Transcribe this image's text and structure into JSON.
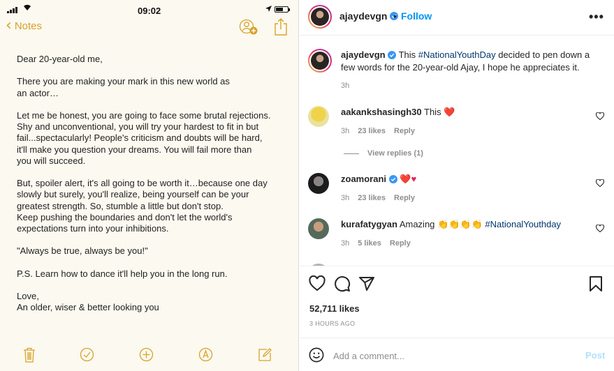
{
  "notes": {
    "status": {
      "time": "09:02"
    },
    "back_label": "Notes",
    "body": {
      "greeting": "Dear 20-year-old me,",
      "p1a": "There you are making your mark in this new world as",
      "p1b": "an actor…",
      "p2a": "Let me be honest, you are going to face some brutal rejections.",
      "p2b": "Shy and unconventional, you will try your hardest to fit in but",
      "p2c": "fail...spectacularly! People's criticism and doubts will be hard,",
      "p2d": "it'll make you question your dreams. You will fail more than",
      "p2e": "you will succeed.",
      "p3a": "But, spoiler alert, it's all going to be worth it…because one day",
      "p3b": "slowly but surely, you'll realize, being yourself can be your",
      "p3c": "greatest strength. So, stumble a little but don't stop.",
      "p3d": "Keep pushing the boundaries and don't let the world's",
      "p3e": "expectations turn into your inhibitions.",
      "quote": "\"Always be true, always be you!\"",
      "ps": "P.S. Learn how to dance it'll help you in the long run.",
      "sign1": "Love,",
      "sign2": "An older, wiser & better looking you"
    },
    "toolbar_icons": [
      "trash-icon",
      "checkmark-circle-icon",
      "plus-circle-icon",
      "markup-pen-icon",
      "compose-icon"
    ]
  },
  "instagram": {
    "header": {
      "username": "ajaydevgn",
      "separator": "•",
      "follow_label": "Follow",
      "more_label": "•••"
    },
    "caption": {
      "username": "ajaydevgn",
      "text_before": "This ",
      "hashtag": "#NationalYouthDay",
      "text_after": " decided to pen down a few words for the 20-year-old Ajay, I hope he appreciates it.",
      "time": "3h"
    },
    "comments": [
      {
        "username": "aakankshasingh30",
        "text": "This ",
        "emoji": "❤️",
        "time": "3h",
        "likes": "23 likes",
        "reply": "Reply"
      },
      {
        "username": "zoamorani",
        "text": "",
        "emoji": "❤️♥",
        "time": "3h",
        "likes": "23 likes",
        "reply": "Reply"
      },
      {
        "username": "kurafatygyan",
        "text": "Amazing ",
        "emoji": "👏👏👏👏",
        "hashtag": " #NationalYouthday",
        "time": "3h",
        "likes": "5 likes",
        "reply": "Reply"
      }
    ],
    "view_replies": "View replies (1)",
    "likes_count": "52,711 likes",
    "time_ago": "3 HOURS AGO",
    "add_comment": {
      "placeholder": "Add a comment...",
      "post_label": "Post"
    },
    "colors": {
      "link_blue": "#0095f6",
      "hashtag": "#00376b",
      "notes_accent": "#d9a22a",
      "heart_red": "#ed4956"
    }
  }
}
